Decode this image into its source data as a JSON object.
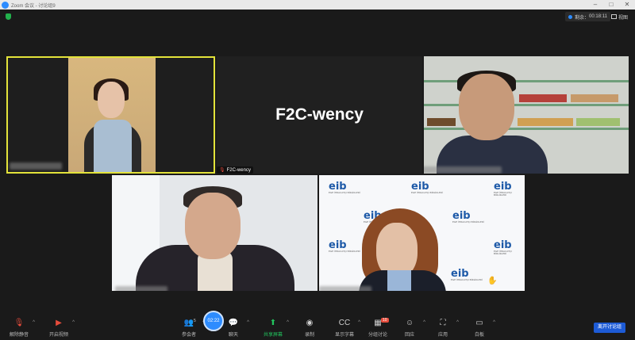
{
  "window": {
    "title": "Zoom 会议 - 讨论组9"
  },
  "header": {
    "remaining_label": "剩余：",
    "remaining_time": "00:18:11",
    "view_label": "视图"
  },
  "participants": [
    {
      "name": ""
    },
    {
      "name": "F2C-wency",
      "big_name": "F2C-wency"
    },
    {
      "name": ""
    },
    {
      "name": ""
    },
    {
      "name": ""
    }
  ],
  "background_logo": {
    "text": "eib",
    "sub": "EGE İHRACATÇI BİRLİKLERİ"
  },
  "toolbar": {
    "unmute": "解除静音",
    "start_video": "开启视频",
    "participants": "参会者",
    "participants_count": "5",
    "clock": "02:22",
    "chat": "聊天",
    "share": "共享屏幕",
    "record": "录制",
    "captions": "显示字幕",
    "breakout": "分组讨论",
    "breakout_badge": "10",
    "reactions": "回应",
    "apps": "应用",
    "whiteboard": "白板",
    "leave": "离开讨论组"
  },
  "colors": {
    "active_speaker": "#e3e33a",
    "accent": "#2d8cff",
    "share_green": "#22c55e",
    "leave_blue": "#1d5bd6"
  }
}
